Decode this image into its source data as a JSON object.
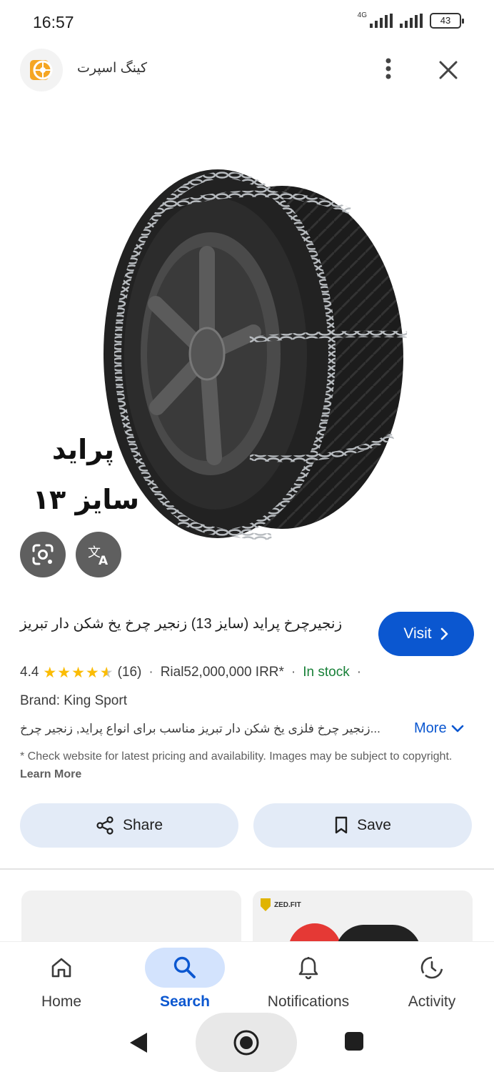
{
  "status_bar": {
    "time": "16:57",
    "network": "4G",
    "battery": "43"
  },
  "header": {
    "site_name": "کینگ اسپرت"
  },
  "image": {
    "overlay_line1": "پراید",
    "overlay_line2": "سایز ۱۳"
  },
  "product": {
    "title": "زنجیرچرخ پراید (سایز 13) زنجیر چرخ یخ شکن دار تبریز",
    "visit_label": "Visit",
    "rating": "4.4",
    "stars_value": 4.4,
    "review_count": "(16)",
    "price": "Rial52,000,000 IRR*",
    "stock": "In stock",
    "brand": "Brand: King Sport",
    "description": "...زنجیر چرخ فلزی یخ شکن دار تبریز مناسب برای انواع پراید, زنجیر چرخ",
    "more_label": "More",
    "disclaimer": "* Check website for latest pricing and availability. Images may be subject to copyright.",
    "learn_more": "Learn More"
  },
  "actions": {
    "share_label": "Share",
    "save_label": "Save"
  },
  "related": {
    "card2_brand": "ZED.FIT"
  },
  "bottom_nav": {
    "items": [
      {
        "label": "Home",
        "icon": "home-icon",
        "active": false
      },
      {
        "label": "Search",
        "icon": "search-icon",
        "active": true
      },
      {
        "label": "Notifications",
        "icon": "bell-icon",
        "active": false
      },
      {
        "label": "Activity",
        "icon": "activity-icon",
        "active": false
      }
    ]
  },
  "colors": {
    "accent": "#0b57d0",
    "in_stock": "#188038",
    "star": "#fbbc04",
    "chip_bg": "#e3ebf7",
    "nav_active_bg": "#d3e3fd"
  }
}
